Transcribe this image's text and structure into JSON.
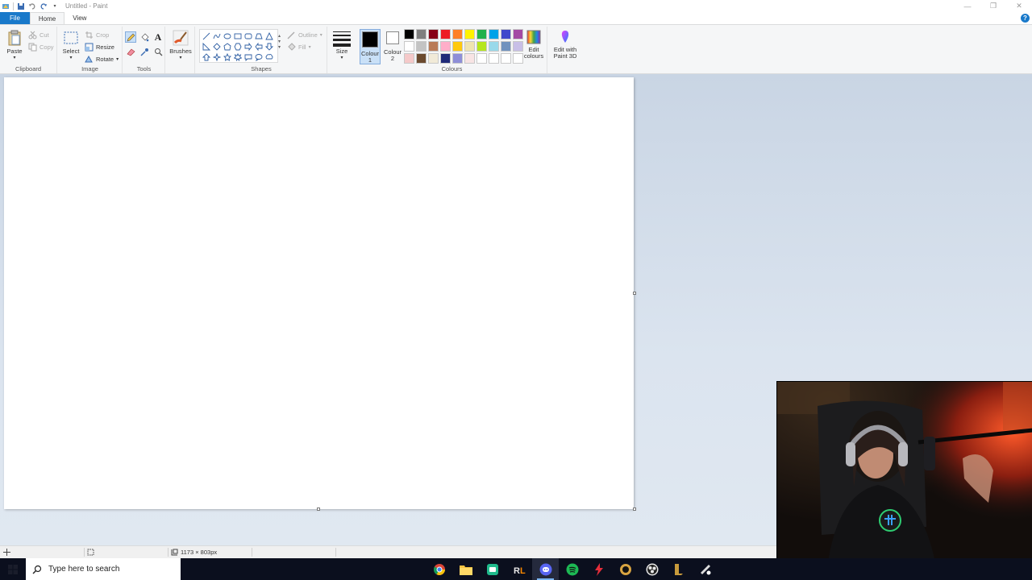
{
  "window": {
    "title": "Untitled - Paint",
    "controls": {
      "minimize": "—",
      "restore": "❐",
      "close": "✕"
    },
    "help": "?"
  },
  "tabs": [
    {
      "label": "File"
    },
    {
      "label": "Home"
    },
    {
      "label": "View"
    }
  ],
  "ribbon": {
    "clipboard": {
      "group_label": "Clipboard",
      "paste": "Paste",
      "cut": "Cut",
      "copy": "Copy"
    },
    "image": {
      "group_label": "Image",
      "select": "Select",
      "crop": "Crop",
      "resize": "Resize",
      "rotate": "Rotate"
    },
    "tools": {
      "group_label": "Tools",
      "text_glyph": "A"
    },
    "brushes": {
      "label": "Brushes"
    },
    "shapes": {
      "group_label": "Shapes",
      "outline": "Outline",
      "fill": "Fill"
    },
    "size": {
      "label": "Size"
    },
    "colours": {
      "group_label": "Colours",
      "colour1_label": "Colour",
      "colour1_num": "1",
      "colour2_label": "Colour",
      "colour2_num": "2",
      "colour1_value": "#000000",
      "colour2_value": "#ffffff",
      "edit_colours_line1": "Edit",
      "edit_colours_line2": "colours",
      "palette": [
        "#000000",
        "#7f7f7f",
        "#880015",
        "#ed1c24",
        "#ff7f27",
        "#fff200",
        "#22b14c",
        "#00a2e8",
        "#3f48cc",
        "#a349a4",
        "#ffffff",
        "#c3c3c3",
        "#b97a57",
        "#ffaec9",
        "#ffc90e",
        "#efe4b0",
        "#b5e61d",
        "#99d9ea",
        "#7092be",
        "#c8bfe7",
        "#f5c9c9",
        "#6b4a2e",
        "#f1ead8",
        "#1f2a78",
        "#8e8ed8",
        "#f8e4e4",
        "#ffffff",
        "#ffffff",
        "#ffffff",
        "#ffffff"
      ]
    },
    "paint3d": {
      "line1": "Edit with",
      "line2": "Paint 3D"
    }
  },
  "status": {
    "dimensions": "1173 × 803px"
  },
  "taskbar": {
    "search_placeholder": "Type here to search",
    "apps": [
      "chrome-icon",
      "file-explorer-icon",
      "app-icon",
      "rocket-league-icon",
      "discord-icon",
      "spotify-icon",
      "bolt-icon",
      "app-icon",
      "app-icon",
      "league-icon",
      "app-icon"
    ]
  }
}
